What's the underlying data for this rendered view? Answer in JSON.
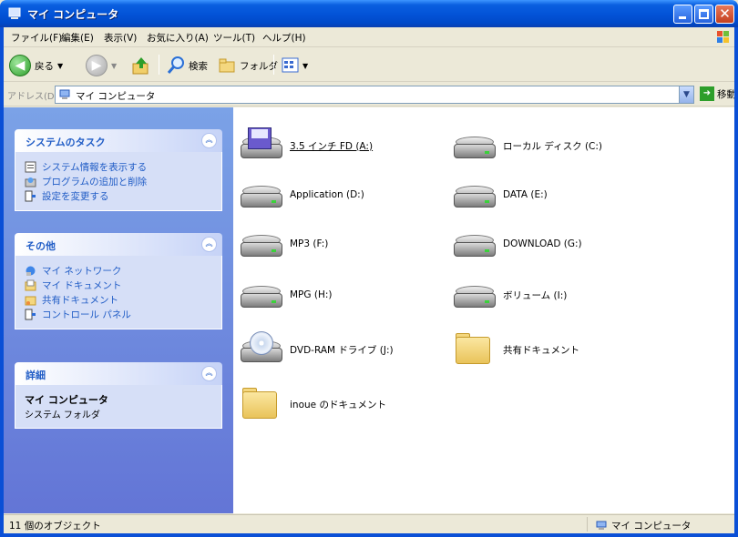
{
  "window": {
    "title": "マイ コンピュータ"
  },
  "menubar": {
    "items": [
      "ファイル(F)",
      "編集(E)",
      "表示(V)",
      "お気に入り(A)",
      "ツール(T)",
      "ヘルプ(H)"
    ]
  },
  "toolbar": {
    "back_label": "戻る",
    "search_label": "検索",
    "folders_label": "フォルダ"
  },
  "address": {
    "label": "アドレス(D)",
    "value": "マイ コンピュータ",
    "go_label": "移動"
  },
  "sidebar": {
    "system_tasks": {
      "title": "システムのタスク",
      "items": [
        "システム情報を表示する",
        "プログラムの追加と削除",
        "設定を変更する"
      ]
    },
    "other_places": {
      "title": "その他",
      "items": [
        "マイ ネットワーク",
        "マイ ドキュメント",
        "共有ドキュメント",
        "コントロール パネル"
      ]
    },
    "details": {
      "title": "詳細",
      "name": "マイ コンピュータ",
      "type": "システム フォルダ"
    }
  },
  "items": [
    {
      "label": "3.5 インチ FD (A:)",
      "icon": "floppy-drive-icon"
    },
    {
      "label": "ローカル ディスク (C:)",
      "icon": "hard-drive-icon"
    },
    {
      "label": "Application (D:)",
      "icon": "hard-drive-icon"
    },
    {
      "label": "DATA (E:)",
      "icon": "hard-drive-icon"
    },
    {
      "label": "MP3 (F:)",
      "icon": "hard-drive-icon"
    },
    {
      "label": "DOWNLOAD (G:)",
      "icon": "hard-drive-icon"
    },
    {
      "label": "MPG (H:)",
      "icon": "hard-drive-icon"
    },
    {
      "label": "ボリューム (I:)",
      "icon": "hard-drive-icon"
    },
    {
      "label": "DVD-RAM ドライブ (J:)",
      "icon": "dvd-drive-icon"
    },
    {
      "label": "共有ドキュメント",
      "icon": "folder-icon"
    },
    {
      "label": "inoue のドキュメント",
      "icon": "folder-icon"
    }
  ],
  "status": {
    "count_text": "11 個のオブジェクト",
    "location": "マイ コンピュータ"
  },
  "colors": {
    "titlebar": "#0354d8",
    "sidebar_gradient_top": "#7ba2e7",
    "sidebar_link": "#215dc6",
    "panel_body": "#d6dff7"
  }
}
